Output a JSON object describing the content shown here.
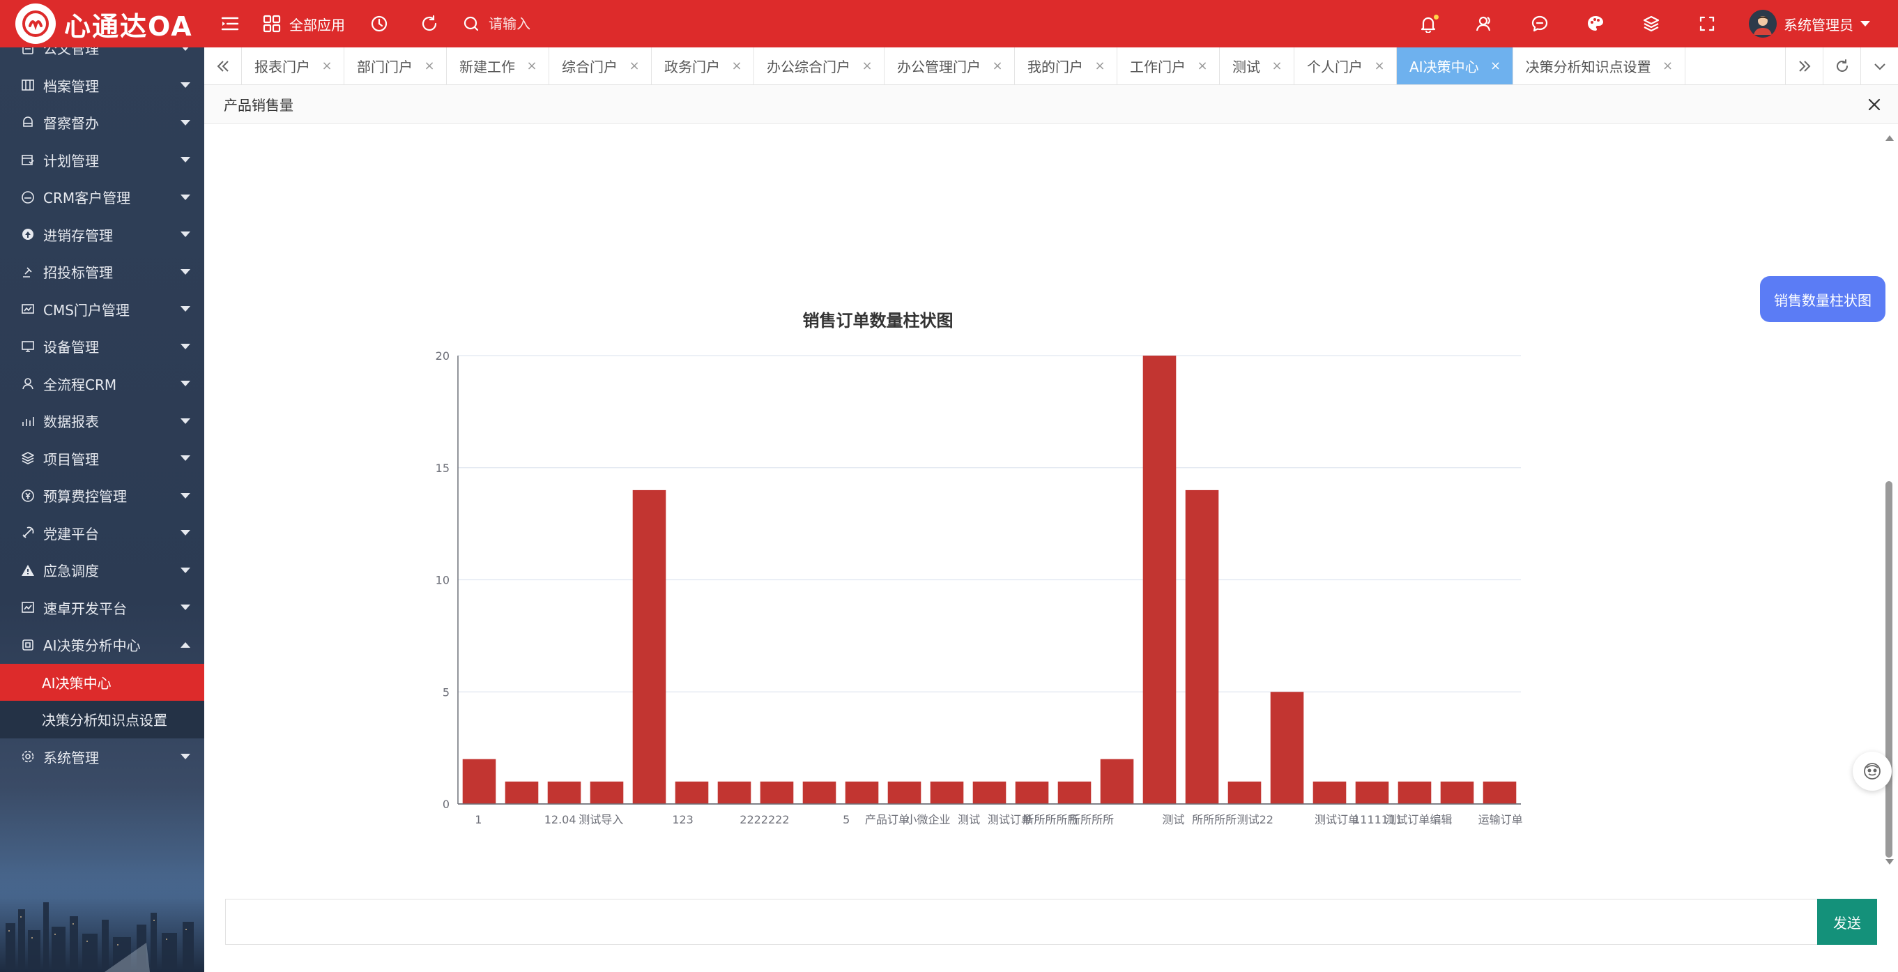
{
  "app": {
    "logo_text": "心通达OA",
    "all_apps_label": "全部应用",
    "search_placeholder": "请输入",
    "user_name": "系统管理员",
    "brand_color": "#dd2b2b"
  },
  "topbar_icons": [
    "menu-toggle-icon",
    "apps-grid-icon",
    "clock-icon",
    "refresh-icon",
    "search-icon",
    "bell-icon",
    "contacts-icon",
    "chat-icon",
    "palette-icon",
    "layers-icon",
    "fullscreen-icon"
  ],
  "sidebar": {
    "items": [
      {
        "label": "公文管理",
        "icon": "document-icon",
        "expanded": false
      },
      {
        "label": "档案管理",
        "icon": "archive-icon",
        "expanded": false
      },
      {
        "label": "督察督办",
        "icon": "supervise-icon",
        "expanded": false
      },
      {
        "label": "计划管理",
        "icon": "plan-icon",
        "expanded": false
      },
      {
        "label": "CRM客户管理",
        "icon": "crm-icon",
        "expanded": false
      },
      {
        "label": "进销存管理",
        "icon": "inventory-icon",
        "expanded": false
      },
      {
        "label": "招投标管理",
        "icon": "bidding-icon",
        "expanded": false
      },
      {
        "label": "CMS门户管理",
        "icon": "cms-icon",
        "expanded": false
      },
      {
        "label": "设备管理",
        "icon": "device-icon",
        "expanded": false
      },
      {
        "label": "全流程CRM",
        "icon": "flow-icon",
        "expanded": false
      },
      {
        "label": "数据报表",
        "icon": "report-icon",
        "expanded": false
      },
      {
        "label": "项目管理",
        "icon": "project-icon",
        "expanded": false
      },
      {
        "label": "预算费控管理",
        "icon": "budget-icon",
        "expanded": false
      },
      {
        "label": "党建平台",
        "icon": "party-icon",
        "expanded": false
      },
      {
        "label": "应急调度",
        "icon": "warning-icon",
        "expanded": false
      },
      {
        "label": "速卓开发平台",
        "icon": "dev-icon",
        "expanded": false
      },
      {
        "label": "AI决策分析中心",
        "icon": "ai-icon",
        "expanded": true
      },
      {
        "label": "系统管理",
        "icon": "settings-icon",
        "expanded": false
      }
    ],
    "sub_items": [
      {
        "label": "AI决策中心",
        "active": true
      },
      {
        "label": "决策分析知识点设置",
        "active": false
      }
    ]
  },
  "tabs": [
    {
      "label": "报表门户",
      "active": false
    },
    {
      "label": "部门门户",
      "active": false
    },
    {
      "label": "新建工作",
      "active": false
    },
    {
      "label": "综合门户",
      "active": false
    },
    {
      "label": "政务门户",
      "active": false
    },
    {
      "label": "办公综合门户",
      "active": false
    },
    {
      "label": "办公管理门户",
      "active": false
    },
    {
      "label": "我的门户",
      "active": false
    },
    {
      "label": "工作门户",
      "active": false
    },
    {
      "label": "测试",
      "active": false
    },
    {
      "label": "个人门户",
      "active": false
    },
    {
      "label": "AI决策中心",
      "active": true
    },
    {
      "label": "决策分析知识点设置",
      "active": false
    }
  ],
  "tab_close_glyph": "×",
  "page": {
    "title": "产品销售量"
  },
  "chat": {
    "user_message": "销售数量柱状图",
    "input_placeholder": "",
    "send_label": "发送"
  },
  "chart_data": {
    "type": "bar",
    "title": "销售订单数量柱状图",
    "xlabel": "",
    "ylabel": "",
    "ylim": [
      0,
      20
    ],
    "yticks": [
      0,
      5,
      10,
      15,
      20
    ],
    "grid": true,
    "bar_color": "#c23531",
    "categories": [
      "1",
      "12.04",
      "测试导入",
      "",
      "123",
      "",
      "2222222",
      "",
      "5",
      "产品订单",
      "小微企业",
      "测试",
      "测试订单",
      "",
      "所所所所",
      "",
      "",
      "测试",
      "所所所所",
      "测试22",
      "",
      "测试订单",
      "1111111",
      "测试订单编辑",
      "",
      "运输订单"
    ],
    "x_tick_labels": [
      "1",
      "",
      "12.04",
      "测试导入",
      "",
      "123",
      "",
      "2222222",
      "",
      "5",
      "产品订单",
      "小微企业",
      "测试",
      "测试订单",
      "所所所所所",
      "所所所所",
      "",
      "测试",
      "所所所所",
      "测试22",
      "",
      "测试订单",
      "1111111",
      "测试订单编辑",
      "",
      "运输订单"
    ],
    "values": [
      2,
      1,
      1,
      1,
      14,
      1,
      1,
      1,
      1,
      1,
      1,
      1,
      1,
      1,
      1,
      2,
      20,
      14,
      1,
      5,
      1,
      1,
      1,
      1,
      1
    ]
  }
}
